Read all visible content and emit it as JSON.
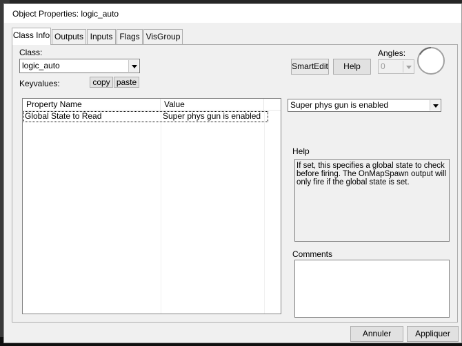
{
  "window": {
    "title": "Object Properties: logic_auto"
  },
  "tabs": [
    {
      "label": "Class Info",
      "active": true
    },
    {
      "label": "Outputs",
      "active": false
    },
    {
      "label": "Inputs",
      "active": false
    },
    {
      "label": "Flags",
      "active": false
    },
    {
      "label": "VisGroup",
      "active": false
    }
  ],
  "class_section": {
    "label": "Class:",
    "value": "logic_auto",
    "keyvalues_label": "Keyvalues:",
    "copy_label": "copy",
    "paste_label": "paste"
  },
  "toolbar": {
    "smartedit_label": "SmartEdit",
    "help_label": "Help",
    "angles_label": "Angles:",
    "angles_value": "0"
  },
  "property_table": {
    "columns": [
      "Property Name",
      "Value"
    ],
    "rows": [
      {
        "name": "Global State to Read",
        "value": "Super phys gun is enabled"
      }
    ]
  },
  "value_combo": {
    "value": "Super phys gun is enabled"
  },
  "help_section": {
    "label": "Help",
    "text": "If set, this specifies a global state to check before firing. The OnMapSpawn output will only fire if the global state is set."
  },
  "comments_section": {
    "label": "Comments",
    "text": ""
  },
  "footer": {
    "cancel_label": "Annuler",
    "apply_label": "Appliquer"
  },
  "colors": {
    "dialog_bg": "#f0f0f0",
    "window_border": "#9a9a9a",
    "editor_background": "#000000"
  }
}
